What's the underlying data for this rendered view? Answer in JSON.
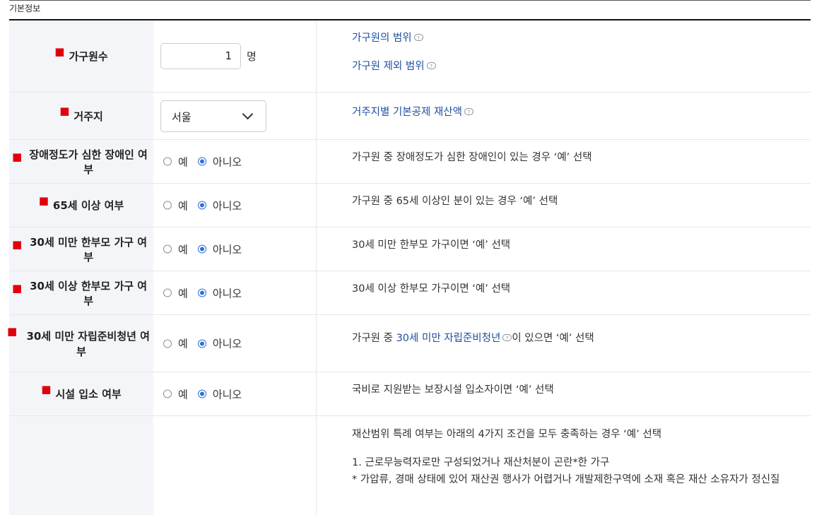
{
  "section": {
    "title": "기본정보"
  },
  "rows": {
    "household": {
      "label": "가구원수",
      "value": "1",
      "unit": "명",
      "link1": "가구원의 범위",
      "link2": "가구원 제외 범위"
    },
    "residence": {
      "label": "거주지",
      "selected": "서울",
      "link": "거주지별 기본공제 재산액"
    },
    "disabled": {
      "label": "장애정도가 심한 장애인 여부",
      "yes": "예",
      "no": "아니오",
      "desc": "가구원 중 장애정도가 심한 장애인이 있는 경우 ‘예’ 선택"
    },
    "senior": {
      "label": "65세 이상 여부",
      "yes": "예",
      "no": "아니오",
      "desc": "가구원 중 65세 이상인 분이 있는 경우 ‘예’ 선택"
    },
    "single_under30": {
      "label": "30세 미만 한부모 가구 여부",
      "yes": "예",
      "no": "아니오",
      "desc": "30세 미만 한부모 가구이면 ‘예’ 선택"
    },
    "single_over30": {
      "label": "30세 이상 한부모 가구 여부",
      "yes": "예",
      "no": "아니오",
      "desc": "30세 이상 한부모 가구이면 ‘예’ 선택"
    },
    "youth": {
      "label_line1": "30세 미만 자립준비청년 여",
      "label_line2": "부",
      "yes": "예",
      "no": "아니오",
      "desc_prefix": "가구원 중 ",
      "desc_link": "30세 미만 자립준비청년",
      "desc_suffix": "이 있으면 ‘예’ 선택"
    },
    "facility": {
      "label": "시설 입소 여부",
      "yes": "예",
      "no": "아니오",
      "desc": "국비로 지원받는 보장시설 입소자이면 ‘예’ 선택"
    },
    "special": {
      "desc_intro": "재산범위 특례 여부는 아래의 4가지 조건을 모두 충족하는 경우 ‘예’ 선택",
      "cond1": "1. 근로무능력자로만 구성되었거나 재산처분이 곤란*한 가구",
      "note1": "* 가압류, 경매 상태에 있어 재산권 행사가 어렵거나 개발제한구역에 소재 혹은 재산 소유자가 정신질"
    }
  },
  "icons": {
    "help": "help-tooltip-icon",
    "chevron": "chevron-down-icon"
  },
  "colors": {
    "required_mark": "#e0000b",
    "link": "#1e4fa0",
    "radio_selected": "#2f6fd6",
    "header_bg": "#f4f5f8"
  }
}
